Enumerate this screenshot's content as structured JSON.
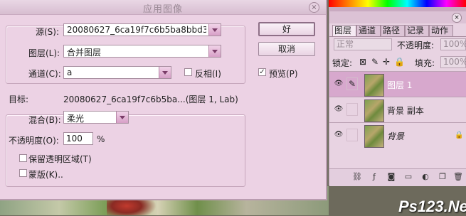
{
  "dialog": {
    "title": "应用图像",
    "source_label": "源(S):",
    "source_value": "20080627_6ca19f7c6b5ba8bbd3...",
    "layer_label": "图层(L):",
    "layer_value": "合并图层",
    "channel_label": "通道(C):",
    "channel_value": "a",
    "invert_label": "反相(I)",
    "target_label": "目标:",
    "target_value": "20080627_6ca19f7c6b5ba...(图层 1, Lab)",
    "blend_label": "混合(B):",
    "blend_value": "柔光",
    "opacity_label": "不透明度(O):",
    "opacity_value": "100",
    "opacity_unit": "%",
    "preserve_transparency_label": "保留透明区域(T)",
    "mask_label": "蒙版(K)..",
    "ok_label": "好",
    "cancel_label": "取消",
    "preview_label": "预览(P)",
    "preview_checked": true
  },
  "layers_panel": {
    "tabs": [
      "图层",
      "通道",
      "路径",
      "记录",
      "动作"
    ],
    "blend_mode": "正常",
    "opacity_label": "不透明度:",
    "opacity_value": "100%",
    "lock_label": "锁定:",
    "fill_label": "填充:",
    "fill_value": "100%",
    "layers": [
      {
        "name": "图层 1",
        "selected": true
      },
      {
        "name": "背景 副本",
        "selected": false
      },
      {
        "name": "背景",
        "selected": false,
        "locked": true
      }
    ]
  },
  "watermark": "Ps123.Net"
}
